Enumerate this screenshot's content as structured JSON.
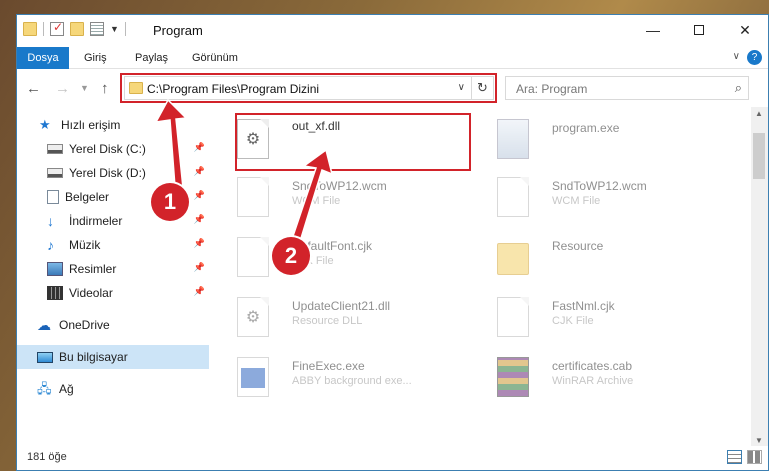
{
  "window": {
    "title": "Program",
    "controls": {
      "minimize": "—",
      "maximize": "",
      "close": "✕"
    }
  },
  "ribbon": {
    "tabs": [
      "Dosya",
      "Giriş",
      "Paylaş",
      "Görünüm"
    ],
    "help": "?"
  },
  "nav": {
    "address": "C:\\Program Files\\Program Dizini",
    "search_placeholder": "Ara: Program"
  },
  "sidebar": {
    "items": [
      {
        "label": "Hızlı erişim",
        "icon": "star-icon"
      },
      {
        "label": "Yerel Disk (C:)",
        "icon": "drive-icon",
        "pinned": true
      },
      {
        "label": "Yerel Disk (D:)",
        "icon": "drive-icon",
        "pinned": true
      },
      {
        "label": "Belgeler",
        "icon": "documents-icon",
        "pinned": true
      },
      {
        "label": "İndirmeler",
        "icon": "download-icon",
        "pinned": true
      },
      {
        "label": "Müzik",
        "icon": "music-icon",
        "pinned": true
      },
      {
        "label": "Resimler",
        "icon": "pictures-icon",
        "pinned": true
      },
      {
        "label": "Videolar",
        "icon": "videos-icon",
        "pinned": true
      },
      {
        "label": "OneDrive",
        "icon": "cloud-icon"
      },
      {
        "label": "Bu bilgisayar",
        "icon": "computer-icon",
        "selected": true
      },
      {
        "label": "Ağ",
        "icon": "network-icon"
      }
    ]
  },
  "files": [
    {
      "name": "out_xf.dll",
      "type": "",
      "icon": "dll-file-icon"
    },
    {
      "name": "program.exe",
      "type": "",
      "icon": "exe-file-icon"
    },
    {
      "name": "SndToWP12.wcm",
      "type": "WCM File",
      "icon": "file-icon"
    },
    {
      "name": "SndToWP12.wcm",
      "type": "WCM File",
      "icon": "file-icon"
    },
    {
      "name": "DefaultFont.cjk",
      "type": "CJK File",
      "icon": "file-icon"
    },
    {
      "name": "Resource",
      "type": "",
      "icon": "folder-icon"
    },
    {
      "name": "UpdateClient21.dll",
      "type": "Resource DLL",
      "icon": "dll-file-icon"
    },
    {
      "name": "FastNml.cjk",
      "type": "CJK File",
      "icon": "file-icon"
    },
    {
      "name": "FineExec.exe",
      "type": "ABBY background exe...",
      "icon": "exe-file-icon"
    },
    {
      "name": "certificates.cab",
      "type": "WinRAR Archive",
      "icon": "archive-icon"
    }
  ],
  "status": {
    "item_count": "181 öğe"
  },
  "callouts": {
    "step1": "1",
    "step2": "2"
  },
  "colors": {
    "accent": "#1979ca",
    "highlight": "#d2232a",
    "selection": "#cce4f7"
  }
}
